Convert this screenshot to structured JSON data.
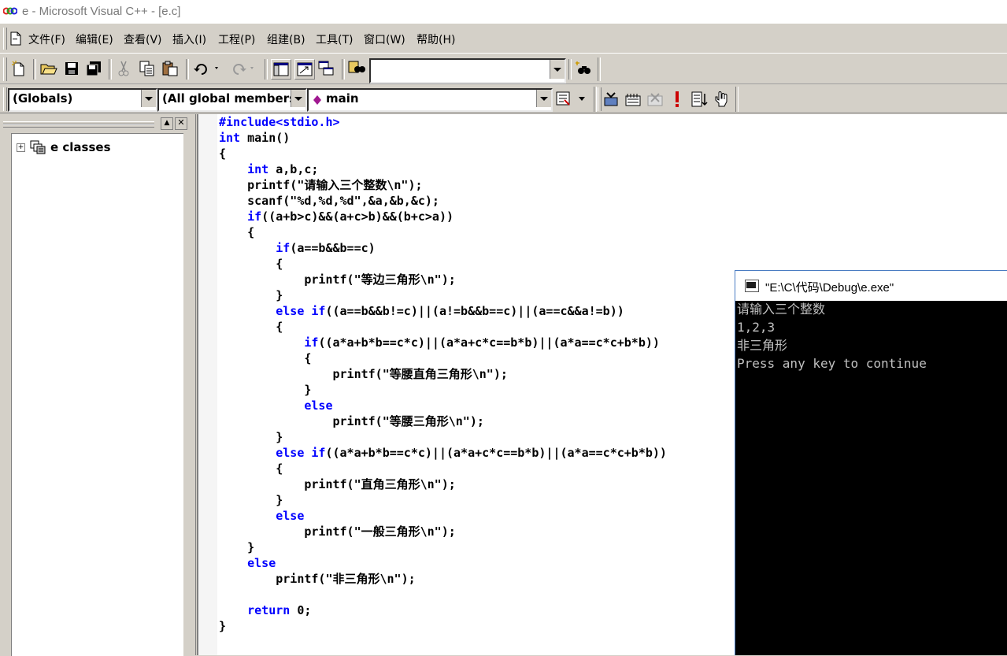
{
  "window": {
    "title": "e - Microsoft Visual C++ - [e.c]"
  },
  "menu": [
    {
      "label": "文件(F)"
    },
    {
      "label": "编辑(E)"
    },
    {
      "label": "查看(V)"
    },
    {
      "label": "插入(I)"
    },
    {
      "label": "工程(P)"
    },
    {
      "label": "组建(B)"
    },
    {
      "label": "工具(T)"
    },
    {
      "label": "窗口(W)"
    },
    {
      "label": "帮助(H)"
    }
  ],
  "toolbar": {
    "find_combo_value": ""
  },
  "wizardbar": {
    "scope": "(Globals)",
    "members": "(All global members",
    "function": "main"
  },
  "workspace": {
    "tree_root": "e classes"
  },
  "editor": {
    "lines": [
      [
        {
          "t": "#include<stdio.h>",
          "k": true
        }
      ],
      [
        {
          "t": "int",
          "k": true
        },
        {
          "t": " main()"
        }
      ],
      [
        {
          "t": "{"
        }
      ],
      [
        {
          "t": "    "
        },
        {
          "t": "int",
          "k": true
        },
        {
          "t": " a,b,c;"
        }
      ],
      [
        {
          "t": "    printf(\"请输入三个整数\\n\");"
        }
      ],
      [
        {
          "t": "    scanf(\"%d,%d,%d\",&a,&b,&c);"
        }
      ],
      [
        {
          "t": "    "
        },
        {
          "t": "if",
          "k": true
        },
        {
          "t": "((a+b>c)&&(a+c>b)&&(b+c>a))"
        }
      ],
      [
        {
          "t": "    {"
        }
      ],
      [
        {
          "t": "        "
        },
        {
          "t": "if",
          "k": true
        },
        {
          "t": "(a==b&&b==c)"
        }
      ],
      [
        {
          "t": "        {"
        }
      ],
      [
        {
          "t": "            printf(\"等边三角形\\n\");"
        }
      ],
      [
        {
          "t": "        }"
        }
      ],
      [
        {
          "t": "        "
        },
        {
          "t": "else if",
          "k": true
        },
        {
          "t": "((a==b&&b!=c)||(a!=b&&b==c)||(a==c&&a!=b))"
        }
      ],
      [
        {
          "t": "        {"
        }
      ],
      [
        {
          "t": "            "
        },
        {
          "t": "if",
          "k": true
        },
        {
          "t": "((a*a+b*b==c*c)||(a*a+c*c==b*b)||(a*a==c*c+b*b))"
        }
      ],
      [
        {
          "t": "            {"
        }
      ],
      [
        {
          "t": "                printf(\"等腰直角三角形\\n\");"
        }
      ],
      [
        {
          "t": "            }"
        }
      ],
      [
        {
          "t": "            "
        },
        {
          "t": "else",
          "k": true
        }
      ],
      [
        {
          "t": "                printf(\"等腰三角形\\n\");"
        }
      ],
      [
        {
          "t": "        }"
        }
      ],
      [
        {
          "t": "        "
        },
        {
          "t": "else if",
          "k": true
        },
        {
          "t": "((a*a+b*b==c*c)||(a*a+c*c==b*b)||(a*a==c*c+b*b))"
        }
      ],
      [
        {
          "t": "        {"
        }
      ],
      [
        {
          "t": "            printf(\"直角三角形\\n\");"
        }
      ],
      [
        {
          "t": "        }"
        }
      ],
      [
        {
          "t": "        "
        },
        {
          "t": "else",
          "k": true
        }
      ],
      [
        {
          "t": "            printf(\"一般三角形\\n\");"
        }
      ],
      [
        {
          "t": "    }"
        }
      ],
      [
        {
          "t": "    "
        },
        {
          "t": "else",
          "k": true
        }
      ],
      [
        {
          "t": "        printf(\"非三角形\\n\");"
        }
      ],
      [
        {
          "t": ""
        }
      ],
      [
        {
          "t": "    "
        },
        {
          "t": "return",
          "k": true
        },
        {
          "t": " 0;"
        }
      ],
      [
        {
          "t": "}"
        }
      ]
    ]
  },
  "console": {
    "title": "\"E:\\C\\代码\\Debug\\e.exe\"",
    "lines": [
      "请输入三个整数",
      "1,2,3",
      "非三角形",
      "Press any key to continue"
    ]
  },
  "colors": {
    "keyword": "#0000ff",
    "console_bg": "#000000",
    "console_fg": "#c0c0c0",
    "chrome": "#d4d0c8"
  },
  "icons": [
    "vc-logo-icon",
    "new-file-icon",
    "open-folder-icon",
    "save-icon",
    "save-all-icon",
    "cut-icon",
    "copy-icon",
    "paste-icon",
    "undo-icon",
    "redo-icon",
    "workspace-icon",
    "output-icon",
    "window-list-icon",
    "find-in-files-icon",
    "find-icon",
    "compile-icon",
    "build-icon",
    "stop-build-icon",
    "execute-icon",
    "go-icon",
    "breakpoint-icon",
    "function-icon",
    "class-icon",
    "console-app-icon"
  ]
}
